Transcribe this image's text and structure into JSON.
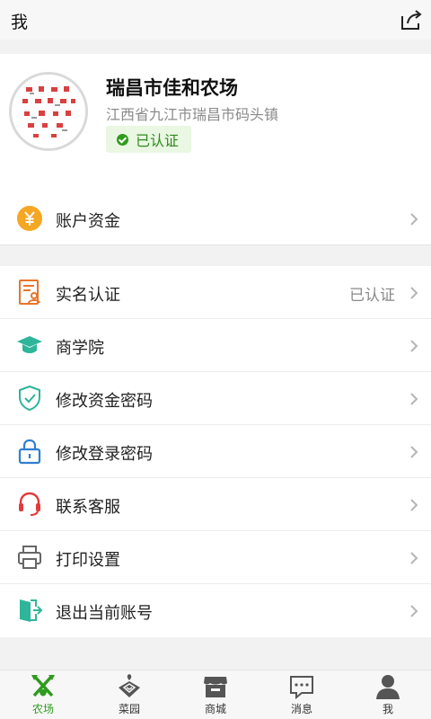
{
  "header": {
    "title": "我"
  },
  "profile": {
    "name": "瑞昌市佳和农场",
    "address": "江西省九江市瑞昌市码头镇",
    "badge": "已认证"
  },
  "account_row": {
    "label": "账户资金"
  },
  "menu": [
    {
      "label": "实名认证",
      "value": "已认证",
      "icon": "id-card-icon"
    },
    {
      "label": "商学院",
      "value": "",
      "icon": "graduation-cap-icon"
    },
    {
      "label": "修改资金密码",
      "value": "",
      "icon": "shield-check-icon"
    },
    {
      "label": "修改登录密码",
      "value": "",
      "icon": "lock-icon"
    },
    {
      "label": "联系客服",
      "value": "",
      "icon": "headset-icon"
    },
    {
      "label": "打印设置",
      "value": "",
      "icon": "printer-icon"
    },
    {
      "label": "退出当前账号",
      "value": "",
      "icon": "logout-icon"
    }
  ],
  "tabs": [
    {
      "label": "农场",
      "icon": "farm-tools-icon",
      "active": true
    },
    {
      "label": "菜园",
      "icon": "garden-plant-icon",
      "active": false
    },
    {
      "label": "商城",
      "icon": "shop-icon",
      "active": false
    },
    {
      "label": "消息",
      "icon": "message-icon",
      "active": false
    },
    {
      "label": "我",
      "icon": "user-icon",
      "active": false
    }
  ],
  "colors": {
    "accent_green": "#2f9b1d",
    "coin_orange": "#f5a623",
    "id_orange": "#e8742a",
    "teal": "#2fb59a",
    "lock_blue": "#2f7fd0",
    "service_red": "#e23b3b"
  }
}
